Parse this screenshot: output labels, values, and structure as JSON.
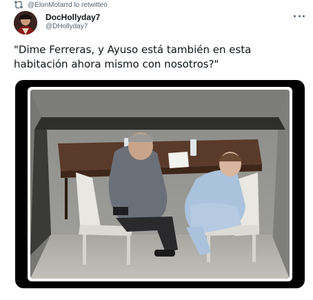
{
  "retweet": {
    "icon": "retweet-icon",
    "text": "@ElonMotarrd lo retwitteó"
  },
  "author": {
    "display_name": "DocHollyday7",
    "handle": "@DHollyday7",
    "avatar_icon": "avatar"
  },
  "tweet": {
    "text": "\"Dime Ferreras, y Ayuso está también en esta habitación ahora mismo con nosotros?\""
  },
  "more_icon": "more-horizontal-icon",
  "colors": {
    "text_primary": "#0f1419",
    "text_secondary": "#536471",
    "media_background": "#000000"
  }
}
